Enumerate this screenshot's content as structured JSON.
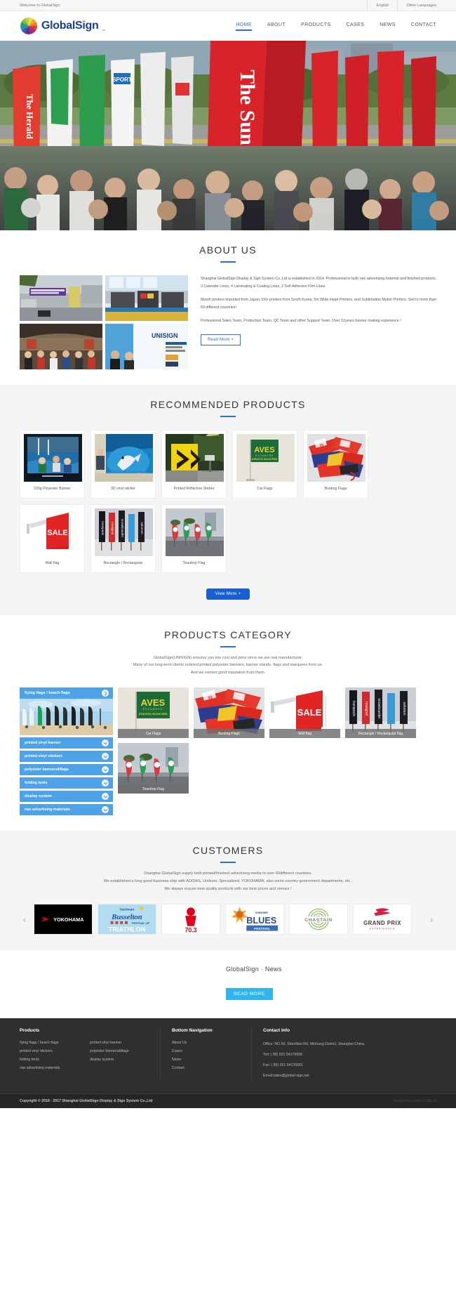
{
  "topbar": {
    "welcome": "Welcome to GlobalSign",
    "lang_en": "English",
    "lang_other": "Other Languages"
  },
  "header": {
    "brand": "GlobalSign",
    "brand_tm": "™",
    "nav": [
      {
        "label": "HOME",
        "active": true
      },
      {
        "label": "ABOUT",
        "active": false
      },
      {
        "label": "PRODUCTS",
        "active": false
      },
      {
        "label": "CASES",
        "active": false
      },
      {
        "label": "NEWS",
        "active": false
      },
      {
        "label": "CONTACT",
        "active": false
      }
    ]
  },
  "about": {
    "title": "ABOUT US",
    "paragraphs": [
      "Shanghai GlobalSign Display & Sign System Co.,Ltd is established in 2014. Professional in both raw advertising material and finished products. 3 Calender Lines, 4 Laminating & Coating Lines, 2 Self Adhesive Flim Lines.",
      "Mutoh printers imported from Japan; DGI printers from South Korea; 5m Wide Inkjet Printers, and Sublimation Mutoh Printers. Sell to more than 60 different countries!",
      "Professional Sales Team, Production Team, QC Team and other Support Team. Over 12years banner making experience !"
    ],
    "read_more": "Read More +",
    "gallery": [
      {
        "name": "factory-entrance-photo"
      },
      {
        "name": "printing-workshop-photo"
      },
      {
        "name": "exhibition-team-photo"
      },
      {
        "name": "unisign-booth-photo"
      }
    ]
  },
  "recommended": {
    "title": "RECOMMENDED PRODUCTS",
    "view_more": "View More +",
    "products": [
      {
        "name": "220g Polyester Banner",
        "image": "kayak-banner-photo"
      },
      {
        "name": "3D vinyl sticker",
        "image": "dolphin-3d-sticker-photo"
      },
      {
        "name": "Printed Reflective Sticker",
        "image": "road-sign-photo"
      },
      {
        "name": "Car Flags",
        "image": "aves-car-flag-photo"
      },
      {
        "name": "Bunting Flags",
        "image": "bunting-flags-photo"
      },
      {
        "name": "Wall flag",
        "image": "sale-wall-flag-photo"
      },
      {
        "name": "Rectangle / Rectangular",
        "image": "rectangle-flags-photo"
      },
      {
        "name": "Teardrop Flag",
        "image": "teardrop-flags-photo"
      }
    ]
  },
  "category": {
    "title": "PRODUCTS CATEGORY",
    "subtitle": [
      "GlobalSign(UNISIGN) ensures you low cost and price since we are real manufacturer.",
      "Many of our long-term clients ordered printed polyester banners, banner stands, flags and marquees from us.",
      "And we earned good reputation from them."
    ],
    "accordion_head": "flying flags / beach flags",
    "accordion_items": [
      "printed vinyl banner",
      "printed vinyl stickers",
      "polyester banners&flags",
      "folding tents",
      "display system",
      "raw advertising materials"
    ],
    "cards": [
      {
        "label": "Car Flags",
        "image": "aves-car-flag-photo"
      },
      {
        "label": "Bunting Flags",
        "image": "bunting-flags-photo"
      },
      {
        "label": "Wall flag",
        "image": "sale-wall-flag-photo"
      },
      {
        "label": "Rectangle / Rectangular flag",
        "image": "rectangle-flags-photo"
      },
      {
        "label": "Teardrop Flag",
        "image": "teardrop-flags-photo"
      }
    ]
  },
  "customers": {
    "title": "CUSTOMERS",
    "subtitle": [
      "Shanghai GlobalSign supply both printed/finished advertising media to over 60different countries.",
      "We established a long good business-ship with ADIDAS, Unilever, Specialized, YOKOHAMA, also some country government departments, etc..",
      "We always ensure best quality products with our best prices and service !"
    ],
    "prev_icon": "chevron-left-icon",
    "next_icon": "chevron-right-icon",
    "logos": [
      {
        "name": "YOKOHAMA"
      },
      {
        "name": "SunSmart Busselton Festival of TRIATHLON"
      },
      {
        "name": "70.3"
      },
      {
        "name": "Cheshire Blues Festival"
      },
      {
        "name": "CHASTAIN"
      },
      {
        "name": "GRAND PRIX EXPERIENCES"
      }
    ]
  },
  "news": {
    "title": "GlobalSign · News",
    "read_more": "READ MORE"
  },
  "footer": {
    "products_title": "Products",
    "products_col1": [
      "flying flags / beach flags",
      "printed vinyl stickers",
      "folding tents",
      "raw advertising materials"
    ],
    "products_col2": [
      "printed vinyl banner",
      "polyester banners&flags",
      "display system"
    ],
    "nav_title": "Bottom Navigation",
    "nav_links": [
      "About Us",
      "Cases",
      "News",
      "Contact"
    ],
    "contact_title": "Contact Info",
    "contact_lines": [
      "Office: NO.59, ShenNan Rd, Minhang District, Shanghai China.",
      "Tell: ( 86) 021 54179996",
      "Fax: ( 86) 021 54176661",
      "Email:sales@global-sign.net"
    ],
    "copyright": "Copyright © 2016 - 2017 Shanghai GlobalSign Display & Sign System Co.,Ltd",
    "designed_by": "Designed by:www.021ffp.cn"
  },
  "colors": {
    "accent_blue": "#2f6dd0",
    "brand_blue": "#1b3f8f",
    "cta_blue": "#1a5fd0",
    "light_blue": "#4ea2e8",
    "news_blue": "#2fb6ef",
    "footer_dark": "#2f2f2f"
  }
}
